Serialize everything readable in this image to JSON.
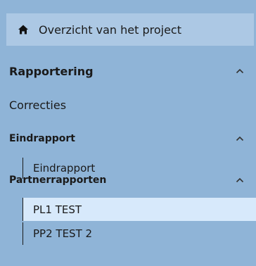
{
  "nav": {
    "overview": {
      "label": "Overzicht van het project",
      "icon": "home-icon"
    },
    "sections": {
      "rapportering": {
        "label": "Rapportering",
        "icon": "chevron-up-icon"
      },
      "correcties": {
        "label": "Correcties"
      },
      "eindrapport": {
        "label": "Eindrapport",
        "icon": "chevron-up-icon",
        "items": [
          {
            "label": "Eindrapport"
          }
        ]
      },
      "partnerrapporten": {
        "label": "Partnerrapporten",
        "icon": "chevron-up-icon",
        "items": [
          {
            "label": "PL1 TEST",
            "selected": true
          },
          {
            "label": "PP2 TEST 2",
            "selected": false
          }
        ]
      }
    }
  },
  "colors": {
    "panel_background": "#8fb4d7",
    "overview_background": "#acc8e4",
    "selected_background": "#d7e9fb",
    "text": "#1a1a1a"
  }
}
